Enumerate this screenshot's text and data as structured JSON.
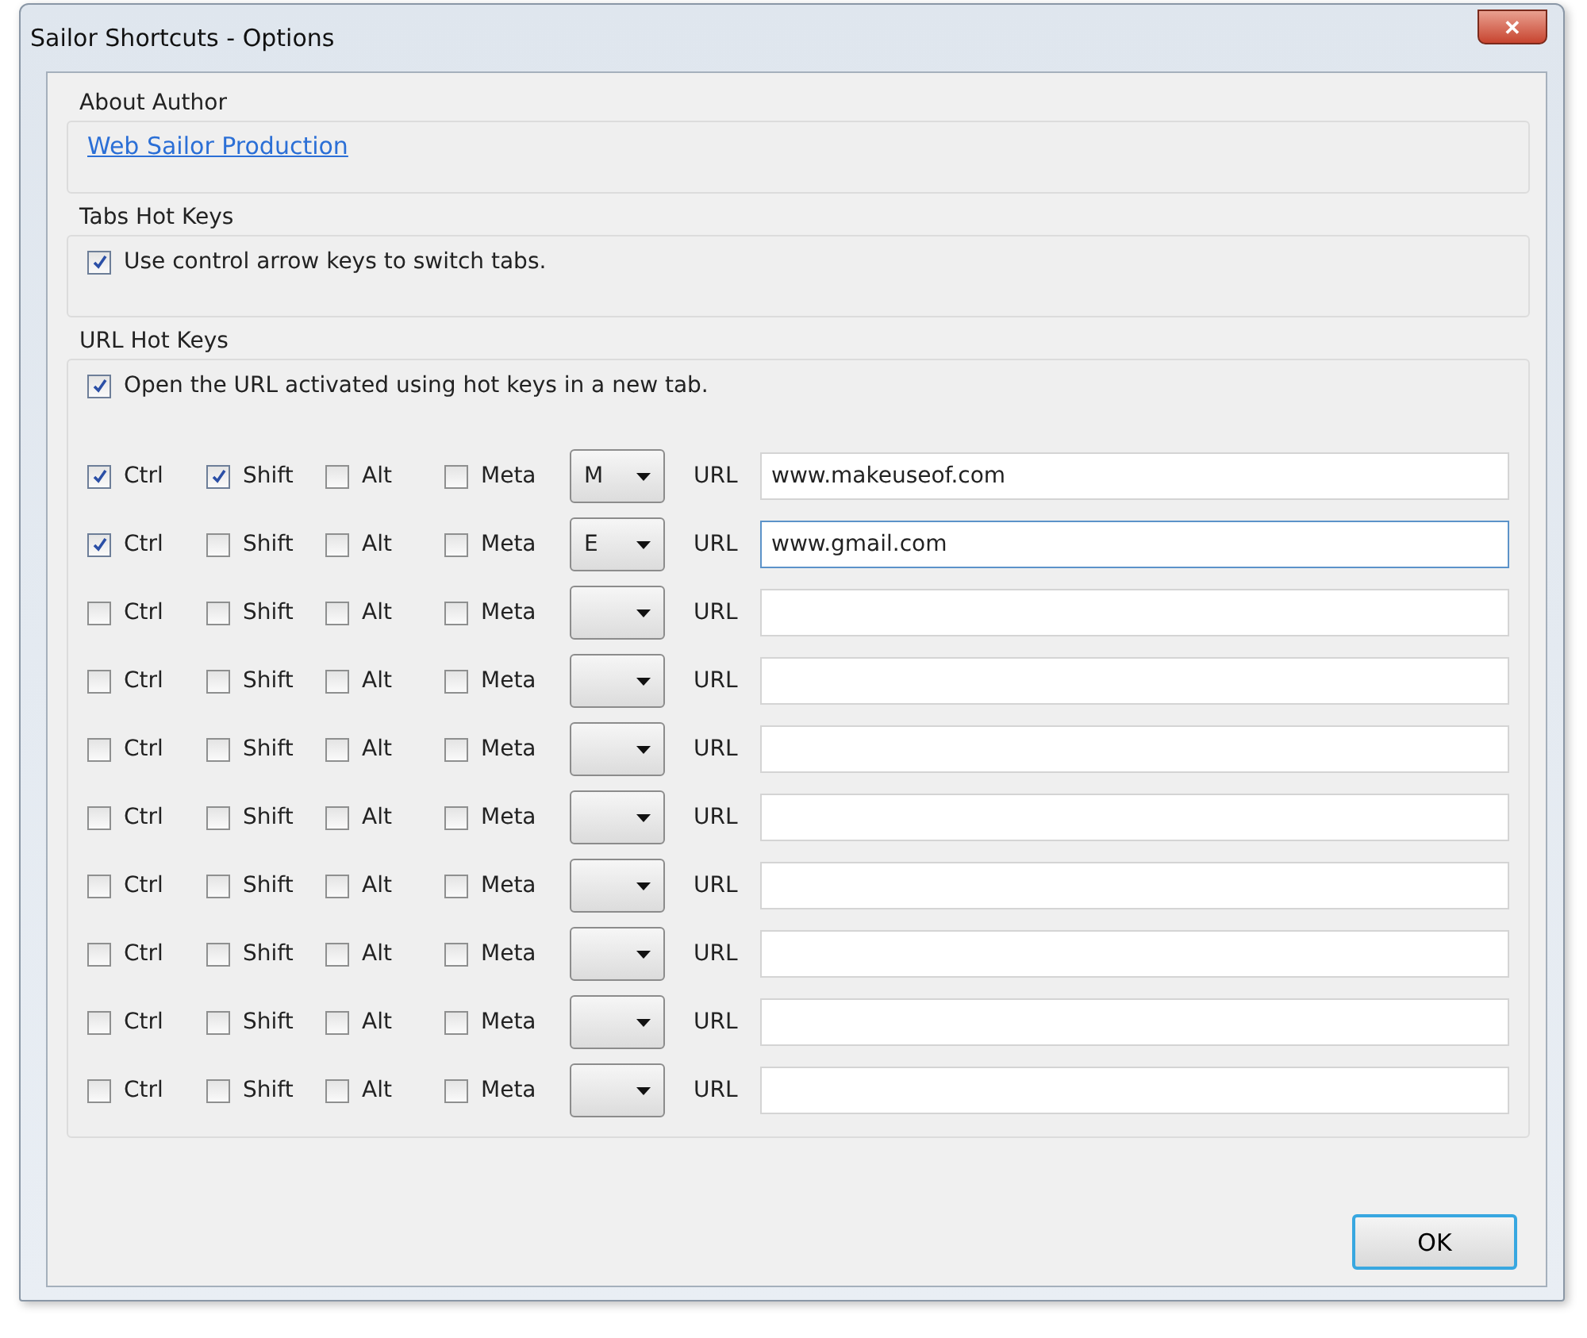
{
  "window": {
    "title": "Sailor Shortcuts - Options",
    "close_glyph": "✕"
  },
  "about": {
    "legend": "About Author",
    "link": "Web Sailor Production"
  },
  "tabs_hot_keys": {
    "legend": "Tabs Hot Keys",
    "option": {
      "label": "Use control arrow keys to switch tabs.",
      "checked": true
    }
  },
  "url_hot_keys": {
    "legend": "URL Hot Keys",
    "option": {
      "label": "Open the URL activated using hot keys in a new tab.",
      "checked": true
    },
    "rows": [
      {
        "modifiers": [
          {
            "label": "Ctrl",
            "checked": true
          },
          {
            "label": "Shift",
            "checked": true
          },
          {
            "label": "Alt",
            "checked": false
          },
          {
            "label": "Meta",
            "checked": false
          }
        ],
        "key": "M",
        "url_label": "URL",
        "url": "www.makeuseof.com",
        "focused": false
      },
      {
        "modifiers": [
          {
            "label": "Ctrl",
            "checked": true
          },
          {
            "label": "Shift",
            "checked": false
          },
          {
            "label": "Alt",
            "checked": false
          },
          {
            "label": "Meta",
            "checked": false
          }
        ],
        "key": "E",
        "url_label": "URL",
        "url": "www.gmail.com",
        "focused": true
      },
      {
        "modifiers": [
          {
            "label": "Ctrl",
            "checked": false
          },
          {
            "label": "Shift",
            "checked": false
          },
          {
            "label": "Alt",
            "checked": false
          },
          {
            "label": "Meta",
            "checked": false
          }
        ],
        "key": "",
        "url_label": "URL",
        "url": "",
        "focused": false
      },
      {
        "modifiers": [
          {
            "label": "Ctrl",
            "checked": false
          },
          {
            "label": "Shift",
            "checked": false
          },
          {
            "label": "Alt",
            "checked": false
          },
          {
            "label": "Meta",
            "checked": false
          }
        ],
        "key": "",
        "url_label": "URL",
        "url": "",
        "focused": false
      },
      {
        "modifiers": [
          {
            "label": "Ctrl",
            "checked": false
          },
          {
            "label": "Shift",
            "checked": false
          },
          {
            "label": "Alt",
            "checked": false
          },
          {
            "label": "Meta",
            "checked": false
          }
        ],
        "key": "",
        "url_label": "URL",
        "url": "",
        "focused": false
      },
      {
        "modifiers": [
          {
            "label": "Ctrl",
            "checked": false
          },
          {
            "label": "Shift",
            "checked": false
          },
          {
            "label": "Alt",
            "checked": false
          },
          {
            "label": "Meta",
            "checked": false
          }
        ],
        "key": "",
        "url_label": "URL",
        "url": "",
        "focused": false
      },
      {
        "modifiers": [
          {
            "label": "Ctrl",
            "checked": false
          },
          {
            "label": "Shift",
            "checked": false
          },
          {
            "label": "Alt",
            "checked": false
          },
          {
            "label": "Meta",
            "checked": false
          }
        ],
        "key": "",
        "url_label": "URL",
        "url": "",
        "focused": false
      },
      {
        "modifiers": [
          {
            "label": "Ctrl",
            "checked": false
          },
          {
            "label": "Shift",
            "checked": false
          },
          {
            "label": "Alt",
            "checked": false
          },
          {
            "label": "Meta",
            "checked": false
          }
        ],
        "key": "",
        "url_label": "URL",
        "url": "",
        "focused": false
      },
      {
        "modifiers": [
          {
            "label": "Ctrl",
            "checked": false
          },
          {
            "label": "Shift",
            "checked": false
          },
          {
            "label": "Alt",
            "checked": false
          },
          {
            "label": "Meta",
            "checked": false
          }
        ],
        "key": "",
        "url_label": "URL",
        "url": "",
        "focused": false
      },
      {
        "modifiers": [
          {
            "label": "Ctrl",
            "checked": false
          },
          {
            "label": "Shift",
            "checked": false
          },
          {
            "label": "Alt",
            "checked": false
          },
          {
            "label": "Meta",
            "checked": false
          }
        ],
        "key": "",
        "url_label": "URL",
        "url": "",
        "focused": false
      }
    ]
  },
  "buttons": [
    {
      "label": "OK"
    }
  ]
}
